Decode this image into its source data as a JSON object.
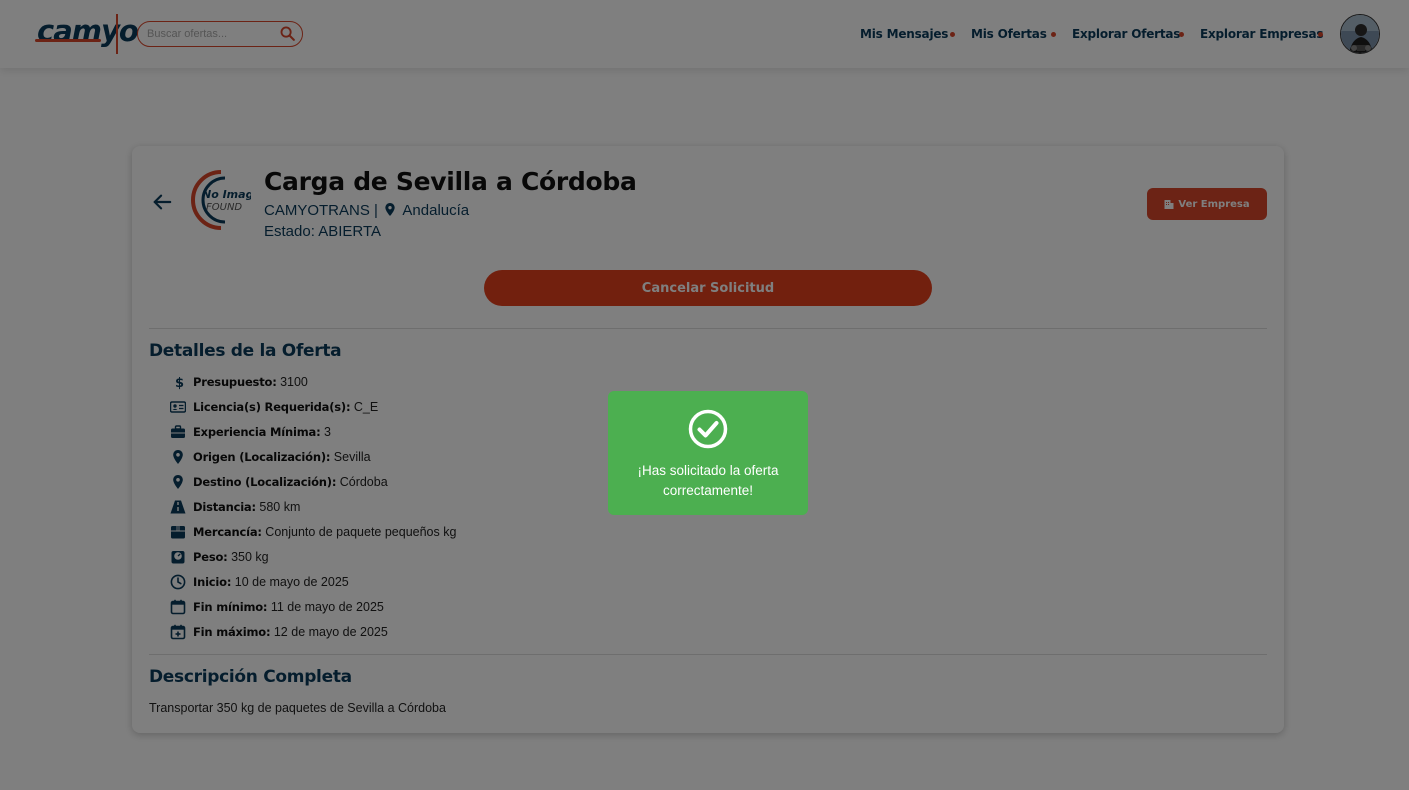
{
  "header": {
    "logo_text": "camyo",
    "search": {
      "placeholder": "Buscar ofertas...",
      "value": ""
    },
    "nav": [
      {
        "label": "Mis Mensajes"
      },
      {
        "label": "Mis Ofertas"
      },
      {
        "label": "Explorar Ofertas"
      },
      {
        "label": "Explorar Empresas"
      }
    ]
  },
  "offer": {
    "logo_text_top": "No Image",
    "logo_text_bottom": "FOUND",
    "title": "Carga de Sevilla a Córdoba",
    "company": "CAMYOTRANS |",
    "location": "Andalucía",
    "status": "Estado: ABIERTA",
    "ver_empresa_label": "Ver Empresa",
    "cancel_label": "Cancelar Solicitud"
  },
  "details": {
    "title": "Detalles de la Oferta",
    "items": [
      {
        "icon": "dollar-icon",
        "label": "Presupuesto:",
        "value": "3100"
      },
      {
        "icon": "license-card-icon",
        "label": "Licencia(s) Requerida(s):",
        "value": "C_E"
      },
      {
        "icon": "briefcase-icon",
        "label": "Experiencia Mínima:",
        "value": "3"
      },
      {
        "icon": "location-pin-icon",
        "label": "Origen (Localización):",
        "value": "Sevilla"
      },
      {
        "icon": "location-pin-icon",
        "label": "Destino (Localización):",
        "value": "Córdoba"
      },
      {
        "icon": "road-icon",
        "label": "Distancia:",
        "value": "580 km"
      },
      {
        "icon": "box-icon",
        "label": "Mercancía:",
        "value": "Conjunto de paquete pequeños kg"
      },
      {
        "icon": "weight-icon",
        "label": "Peso:",
        "value": "350 kg"
      },
      {
        "icon": "clock-icon",
        "label": "Inicio:",
        "value": "10 de mayo de 2025"
      },
      {
        "icon": "calendar-icon",
        "label": "Fin mínimo:",
        "value": "11 de mayo de 2025"
      },
      {
        "icon": "calendar-plus-icon",
        "label": "Fin máximo:",
        "value": "12 de mayo de 2025"
      }
    ]
  },
  "description": {
    "title": "Descripción Completa",
    "text": "Transportar 350 kg de paquetes de Sevilla a Córdoba"
  },
  "toast": {
    "icon": "check-circle-icon",
    "message": "¡Has solicitado la oferta correctamente!"
  },
  "colors": {
    "primary": "#d9462a",
    "navy": "#0b3b5a",
    "success": "#4caf50"
  }
}
